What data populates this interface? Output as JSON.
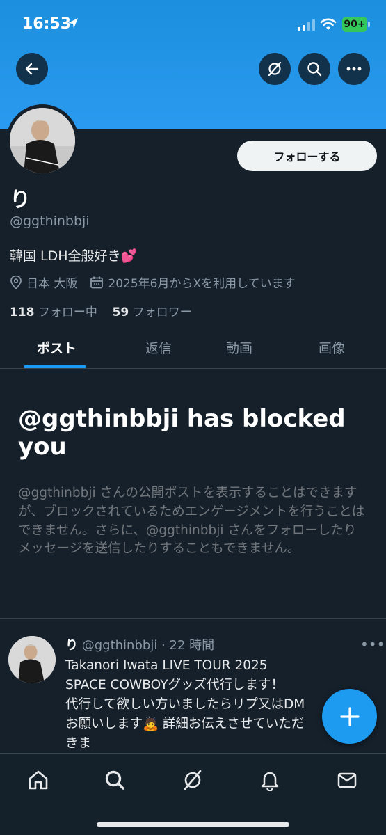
{
  "status_bar": {
    "time": "16:53",
    "battery": "90+"
  },
  "profile": {
    "display_name": "り",
    "handle": "@ggthinbbji",
    "bio": "韓国 LDH全般好き💕",
    "location": "日本 大阪",
    "joined": "2025年6月からXを利用しています",
    "following_count": "118",
    "following_label": "フォロー中",
    "followers_count": "59",
    "followers_label": "フォロワー",
    "follow_button": "フォローする"
  },
  "tabs": [
    {
      "label": "ポスト",
      "active": true
    },
    {
      "label": "返信",
      "active": false
    },
    {
      "label": "動画",
      "active": false
    },
    {
      "label": "画像",
      "active": false
    }
  ],
  "blocked_notice": {
    "title": "@ggthinbbji has blocked you",
    "body": "@ggthinbbji さんの公開ポストを表示することはできますが、ブロックされているためエンゲージメントを行うことはできません。さらに、@ggthinbbji さんをフォローしたりメッセージを送信したりすることもできません。"
  },
  "post": {
    "name": "り",
    "handle_time": "@ggthinbbji · 22 時間",
    "more": "•••",
    "text": "Takanori Iwata LIVE TOUR 2025\nSPACE COWBOYグッズ代行します！\n代行して欲しい方いましたらリプ又はDM\nお願いします🙇 詳細お伝えさせていただきま\nす🙇"
  },
  "colors": {
    "accent": "#1d9bf0",
    "background": "#15202b",
    "banner": "#2a9af0"
  },
  "icons": {
    "header": [
      "back-arrow-icon",
      "grok-icon",
      "search-icon",
      "more-icon"
    ],
    "nav": [
      "home-icon",
      "search-icon",
      "grok-icon",
      "bell-icon",
      "mail-icon"
    ]
  }
}
